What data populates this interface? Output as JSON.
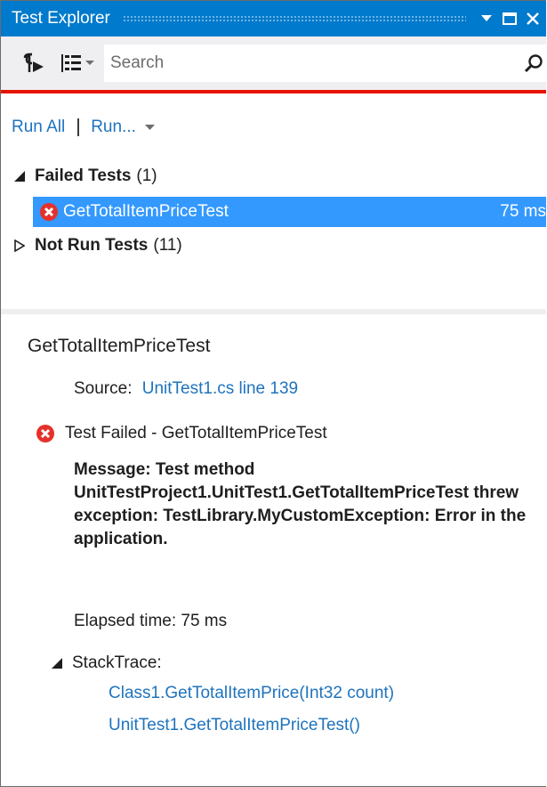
{
  "window": {
    "title": "Test Explorer"
  },
  "toolbar": {
    "run_icon": "run-tests-icon",
    "group_icon": "group-by-icon",
    "search_placeholder": "Search"
  },
  "commands": {
    "run_all": "Run All",
    "run": "Run..."
  },
  "groups": {
    "failed": {
      "name": "Failed Tests",
      "count": "(1)"
    },
    "not_run": {
      "name": "Not Run Tests",
      "count": "(11)"
    }
  },
  "tests": [
    {
      "name": "GetTotalItemPriceTest",
      "time": "75 ms",
      "status": "failed",
      "status_color": "#e5312b"
    }
  ],
  "details": {
    "title": "GetTotalItemPriceTest",
    "source_label": "Source:",
    "source_link": "UnitTest1.cs line 139",
    "status_text": "Test Failed - GetTotalItemPriceTest",
    "message": "Message: Test method UnitTestProject1.UnitTest1.GetTotalItemPriceTest threw exception: TestLibrary.MyCustomException: Error in the application.",
    "elapsed": "Elapsed time: 75 ms",
    "stacktrace_label": "StackTrace:",
    "stacktrace": [
      "Class1.GetTotalItemPrice(Int32 count)",
      "UnitTest1.GetTotalItemPriceTest()"
    ]
  },
  "colors": {
    "title_bar": "#007acc",
    "accent_red": "#e51400",
    "selection": "#3399ff",
    "link": "#1e73be"
  }
}
